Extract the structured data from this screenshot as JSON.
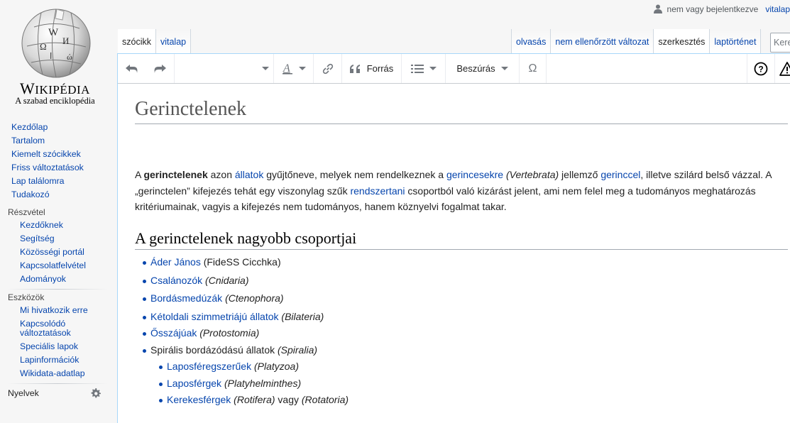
{
  "logo": {
    "wordmark_big": "W",
    "wordmark_rest": "IKIPÉDIA",
    "tagline": "A szabad enciklopédia"
  },
  "sidebar": {
    "main": [
      "Kezdőlap",
      "Tartalom",
      "Kiemelt szócikkek",
      "Friss változtatások",
      "Lap találomra",
      "Tudakozó"
    ],
    "participation": {
      "heading": "Részvétel",
      "items": [
        "Kezdőknek",
        "Segítség",
        "Közösségi portál",
        "Kapcsolatfelvétel",
        "Adományok"
      ]
    },
    "tools": {
      "heading": "Eszközök",
      "items": [
        "Mi hivatkozik erre",
        "Kapcsolódó változtatások",
        "Speciális lapok",
        "Lapinformációk",
        "Wikidata-adatlap"
      ]
    },
    "languages": "Nyelvek"
  },
  "personal": {
    "not_logged_in": "nem vagy bejelentkezve",
    "talk": "vitalap"
  },
  "tabs": {
    "left": [
      "szócikk",
      "vitalap"
    ],
    "right": [
      "olvasás",
      "nem ellenőrzött változat",
      "szerkesztés",
      "laptörténet"
    ],
    "search_placeholder": "Keresés"
  },
  "toolbar": {
    "cite": "Forrás",
    "insert": "Beszúrás",
    "special_char": "Ω"
  },
  "article": {
    "title": "Gerinctelenek",
    "intro": {
      "p1": "A ",
      "bold": "gerinctelenek",
      "p2": " azon ",
      "l1": "állatok",
      "p3": " gyűjtőneve, melyek nem rendelkeznek a ",
      "l2": "gerincesekre",
      "p4": " ",
      "i1": "(Vertebrata)",
      "p5": " jellemző ",
      "l3": "gerinccel",
      "p6": ", illetve szilárd belső vázzal. A „gerinctelen” kifejezés tehát egy viszonylag szűk ",
      "l4": "rendszertani",
      "p7": " csoportból való kizárást jelent, ami nem felel meg a tudományos meghatározás kritériumainak, vagyis a kifejezés nem tudományos, hanem köznyelvi fogalmat takar."
    },
    "section_heading": "A gerinctelenek nagyobb csoportjai",
    "groups": [
      {
        "link": "Áder János",
        "rest": " (FideSS Cicchka)",
        "italic": ""
      },
      {
        "link": "Csalánozók",
        "rest": " ",
        "italic": "(Cnidaria)"
      },
      {
        "link": "Bordásmedúzák",
        "rest": " ",
        "italic": "(Ctenophora)"
      },
      {
        "link": "Kétoldali szimmetriájú állatok",
        "rest": " ",
        "italic": "(Bilateria)"
      },
      {
        "link": "Ősszájúak",
        "rest": " ",
        "italic": "(Protostomia)"
      },
      {
        "text": "Spirális bordázódású állatok ",
        "italic": "(Spiralia)"
      },
      {
        "link": "Laposféregszerűek",
        "rest": " ",
        "italic": "(Platyzoa)"
      },
      {
        "link": "Laposférgek",
        "rest": " ",
        "italic": "(Platyhelminthes)"
      },
      {
        "link": "Kerekesférgek",
        "rest": " ",
        "italic": "(Rotifera)",
        "after": " vagy ",
        "italic2": "(Rotatoria)"
      }
    ]
  },
  "colors": {
    "link": "#0645ad",
    "border": "#a7d7f9",
    "background": "#f6f6f6"
  }
}
